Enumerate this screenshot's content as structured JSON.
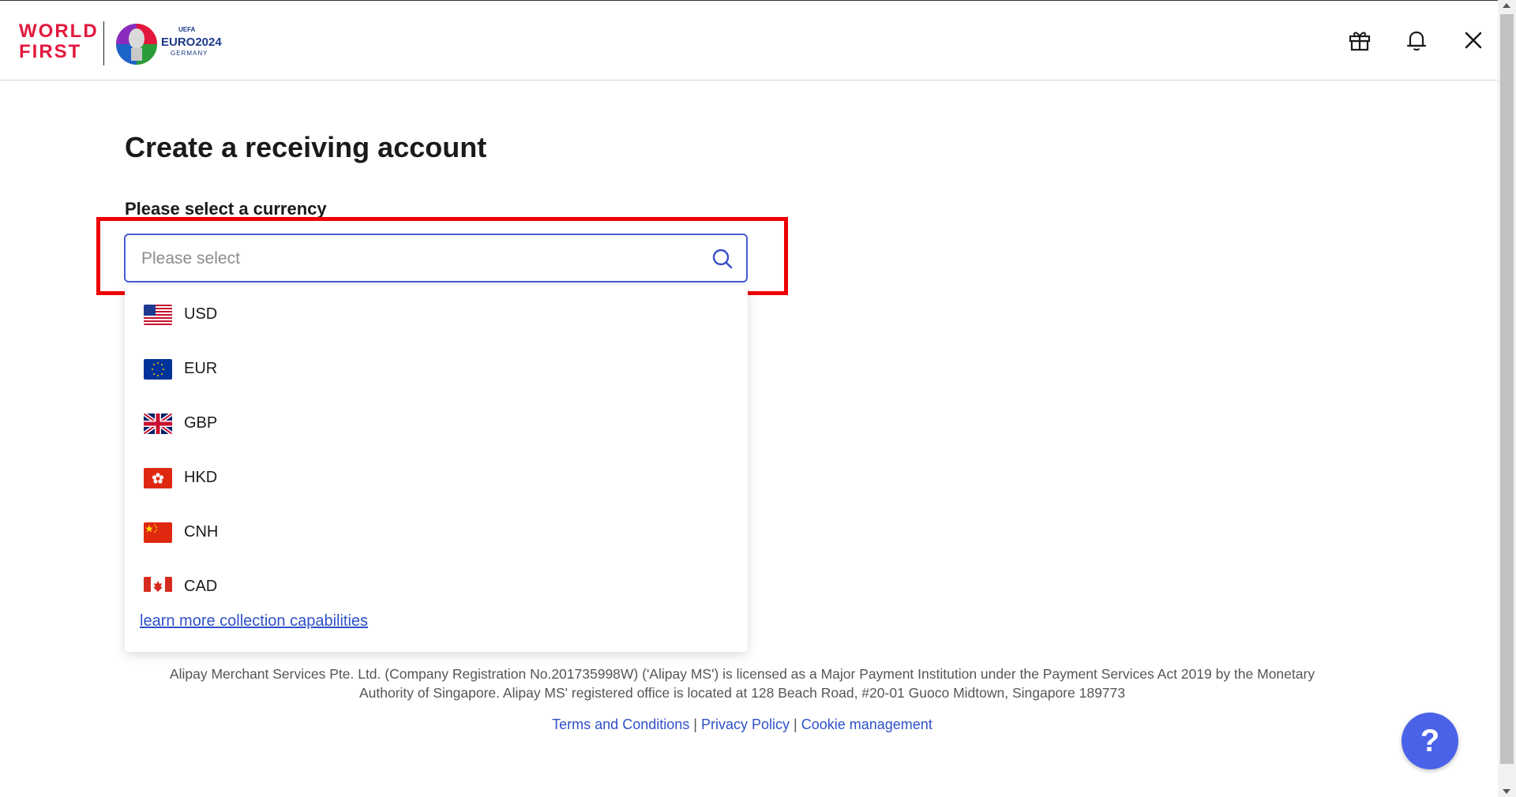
{
  "header": {
    "brand_line1": "WORLD",
    "brand_line2": "FIRST",
    "partner_uefa": "UEFA",
    "partner_logo_text": "EURO2024",
    "partner_logo_sub": "GERMANY",
    "icons": [
      "gift-icon",
      "bell-icon",
      "close-icon"
    ]
  },
  "main": {
    "title": "Create a receiving account",
    "currency_label": "Please select a currency",
    "search_placeholder": "Please select",
    "search_value": "",
    "currencies": [
      {
        "code": "USD",
        "flag": "us-flag-icon"
      },
      {
        "code": "EUR",
        "flag": "eu-flag-icon"
      },
      {
        "code": "GBP",
        "flag": "uk-flag-icon"
      },
      {
        "code": "HKD",
        "flag": "hk-flag-icon"
      },
      {
        "code": "CNH",
        "flag": "cn-flag-icon"
      },
      {
        "code": "CAD",
        "flag": "ca-flag-icon"
      }
    ],
    "learn_more": "learn more collection capabilities"
  },
  "footer": {
    "legal_line1": "Alipay Merchant Services Pte. Ltd. (Company Registration No.201735998W) ('Alipay MS') is licensed as a Major Payment Institution under the Payment Services Act 2019 by the Monetary",
    "legal_line2": "Authority of Singapore. Alipay MS' registered office is located at 128 Beach Road, #20-01 Guoco Midtown, Singapore 189773",
    "links": [
      "Terms and Conditions",
      "Privacy Policy",
      "Cookie management"
    ],
    "separator": "|"
  },
  "help_button": "?",
  "colors": {
    "brand_red": "#e3183d",
    "accent_blue": "#4a5bd6",
    "link_blue": "#2f50c8",
    "highlight_red": "#ee0000",
    "help_button_bg": "#4a62e8"
  }
}
